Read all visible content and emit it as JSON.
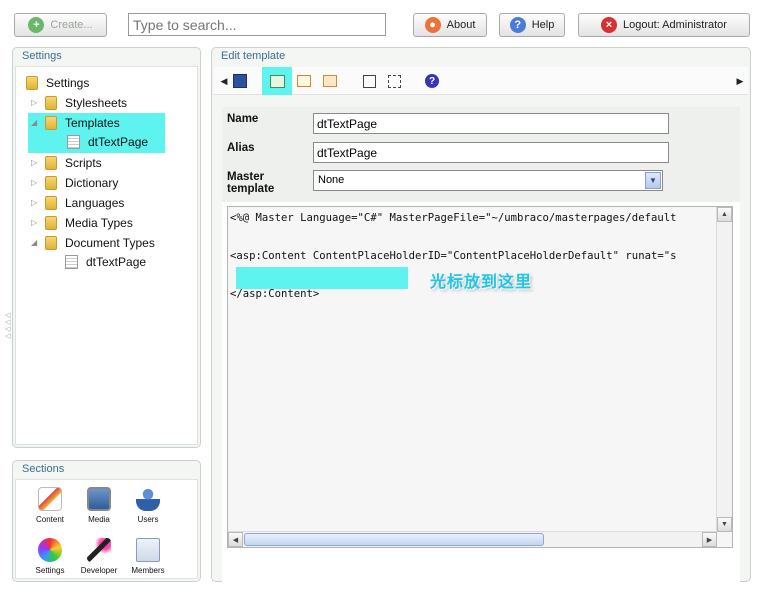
{
  "topbar": {
    "create_label": "Create...",
    "search_placeholder": "Type to search...",
    "about_label": "About",
    "help_label": "Help",
    "logout_label": "Logout: Administrator"
  },
  "settings": {
    "title": "Settings",
    "root_label": "Settings",
    "items": [
      {
        "label": "Stylesheets"
      },
      {
        "label": "Templates"
      },
      {
        "label": "dtTextPage"
      },
      {
        "label": "Scripts"
      },
      {
        "label": "Dictionary"
      },
      {
        "label": "Languages"
      },
      {
        "label": "Media Types"
      },
      {
        "label": "Document Types"
      },
      {
        "label": "dtTextPage"
      }
    ]
  },
  "sections": {
    "title": "Sections",
    "items": [
      {
        "label": "Content",
        "icon": "content-icon"
      },
      {
        "label": "Media",
        "icon": "media-icon"
      },
      {
        "label": "Users",
        "icon": "users-icon"
      },
      {
        "label": "Settings",
        "icon": "settings-icon"
      },
      {
        "label": "Developer",
        "icon": "developer-icon"
      },
      {
        "label": "Members",
        "icon": "members-icon"
      }
    ]
  },
  "editor": {
    "title": "Edit template",
    "name_label": "Name",
    "name_value": "dtTextPage",
    "alias_label": "Alias",
    "alias_value": "dtTextPage",
    "master_label": "Master template",
    "master_value": "None",
    "code_lines": [
      "<%@ Master Language=\"C#\" MasterPageFile=\"~/umbraco/masterpages/default",
      "<asp:Content ContentPlaceHolderID=\"ContentPlaceHolderDefault\" runat=\"s",
      "</asp:Content>"
    ],
    "annotation": "光标放到这里"
  },
  "colors": {
    "highlight": "#5ef3ef",
    "panel_title": "#3d6e8d",
    "annotation": "#22c6e5"
  }
}
